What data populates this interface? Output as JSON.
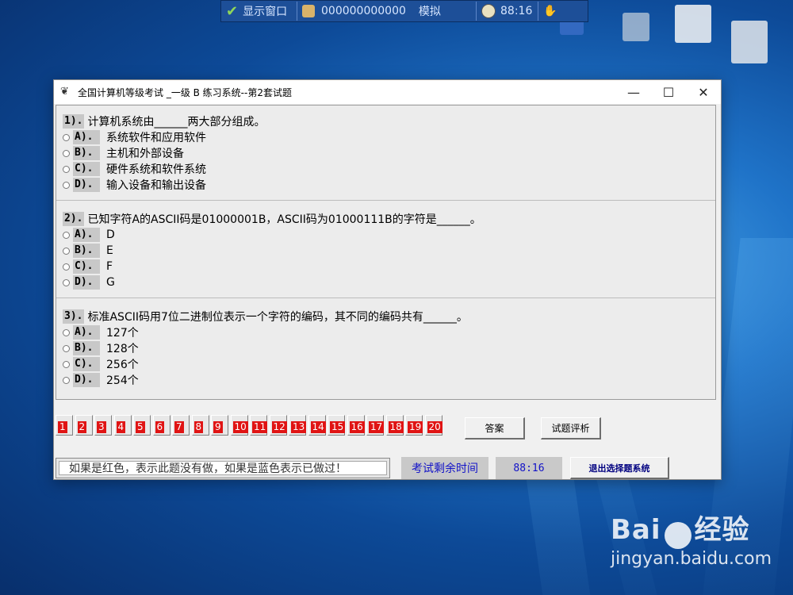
{
  "taskbar": {
    "show_window": "显示窗口",
    "candidate_id": "000000000000",
    "mode": "模拟",
    "timer": "88:16"
  },
  "window": {
    "title": "全国计算机等级考试 _一级 B 练习系统--第2套试题",
    "minimize": "—",
    "maximize": "☐",
    "close": "✕"
  },
  "questions": [
    {
      "num": "1).",
      "text": "计算机系统由______两大部分组成。",
      "options": [
        {
          "key": "A).",
          "text": "系统软件和应用软件"
        },
        {
          "key": "B).",
          "text": "主机和外部设备"
        },
        {
          "key": "C).",
          "text": "硬件系统和软件系统"
        },
        {
          "key": "D).",
          "text": "输入设备和输出设备"
        }
      ]
    },
    {
      "num": "2).",
      "text": "已知字符A的ASCII码是01000001B，ASCII码为01000111B的字符是______。",
      "options": [
        {
          "key": "A).",
          "text": "D"
        },
        {
          "key": "B).",
          "text": "E"
        },
        {
          "key": "C).",
          "text": "F"
        },
        {
          "key": "D).",
          "text": "G"
        }
      ]
    },
    {
      "num": "3).",
      "text": "标准ASCII码用7位二进制位表示一个字符的编码，其不同的编码共有______。",
      "options": [
        {
          "key": "A).",
          "text": "127个"
        },
        {
          "key": "B).",
          "text": "128个"
        },
        {
          "key": "C).",
          "text": "256个"
        },
        {
          "key": "D).",
          "text": "254个"
        }
      ]
    }
  ],
  "question_numbers": [
    "1",
    "2",
    "3",
    "4",
    "5",
    "6",
    "7",
    "8",
    "9",
    "10",
    "11",
    "12",
    "13",
    "14",
    "15",
    "16",
    "17",
    "18",
    "19",
    "20"
  ],
  "buttons": {
    "answer": "答案",
    "analysis": "试题评析",
    "exit": "退出选择题系统"
  },
  "status": {
    "hint": "如果是红色，表示此题没有做，如果是蓝色表示已做过！",
    "time_label": "考试剩余时间",
    "time_value": "88:16"
  },
  "watermark": {
    "logo_left": "Bai",
    "logo_right": "经验",
    "url": "jingyan.baidu.com"
  },
  "colors": {
    "unanswered": "#e01414",
    "time_text": "#1212c8"
  }
}
